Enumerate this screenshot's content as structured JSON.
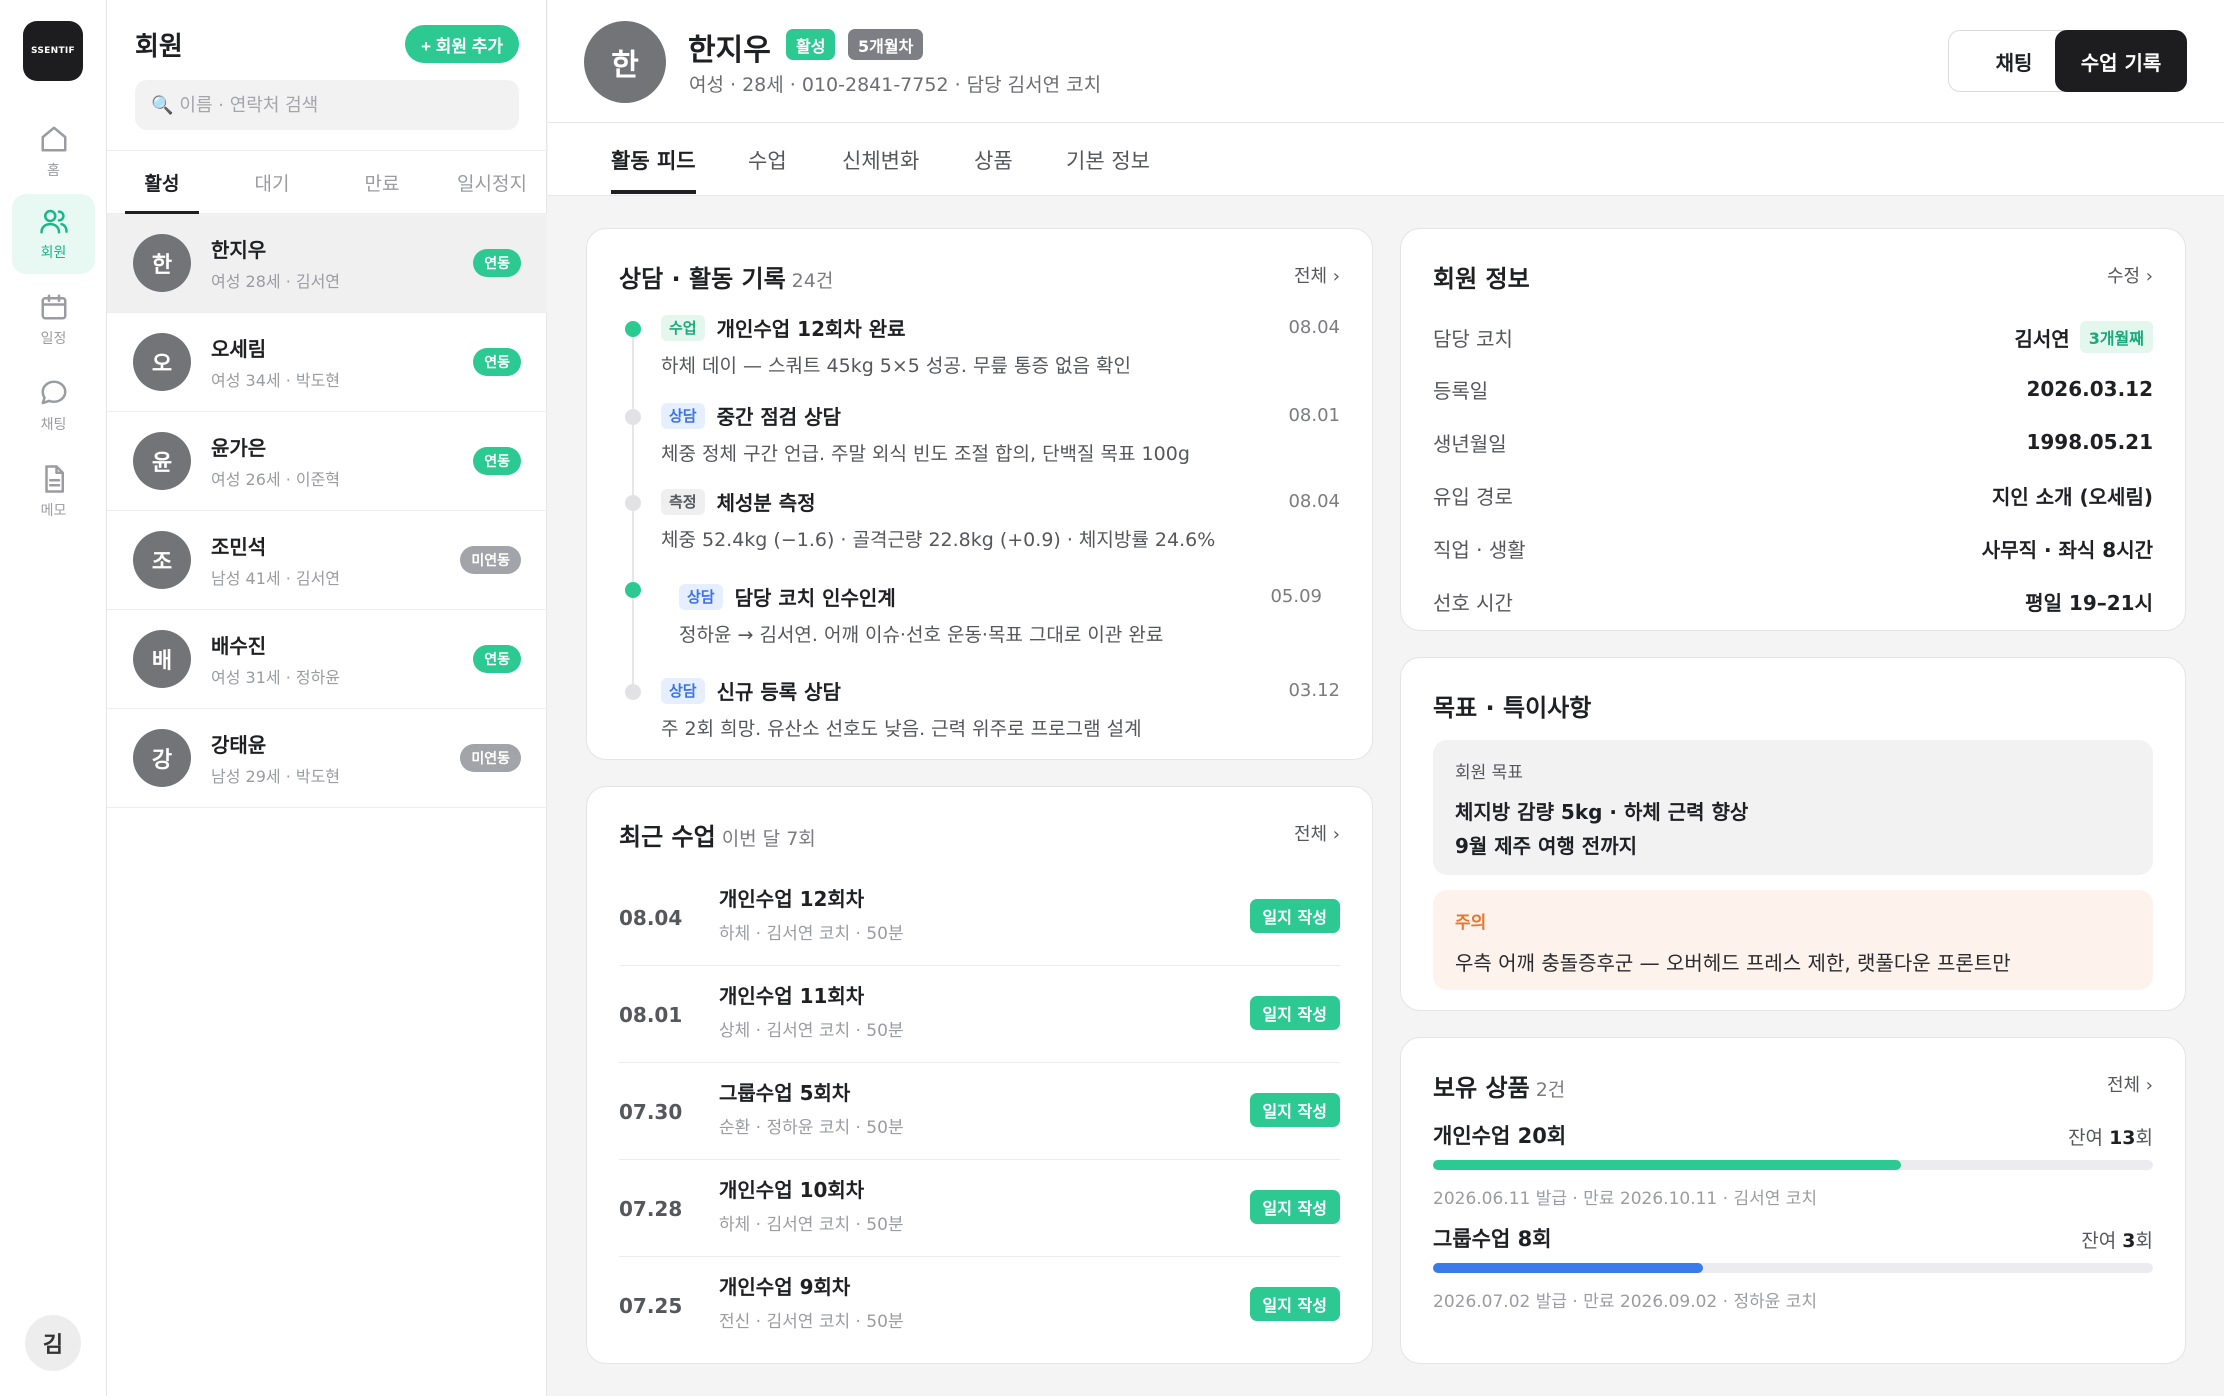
{
  "app": {
    "logo": "SSENTIF"
  },
  "rail": [
    {
      "icon": "home-icon",
      "label": "홈"
    },
    {
      "icon": "members-icon",
      "label": "회원"
    },
    {
      "icon": "calendar-icon",
      "label": "일정"
    },
    {
      "icon": "chat-icon",
      "label": "채팅"
    },
    {
      "icon": "memo-icon",
      "label": "메모"
    }
  ],
  "user_avatar": "김",
  "members_panel": {
    "title": "회원",
    "add_label": "+ 회원 추가",
    "search_placeholder": "이름 · 연락처 검색",
    "tabs": [
      "활성",
      "대기",
      "만료",
      "일시정지"
    ],
    "members": [
      {
        "initial": "한",
        "name": "한지우",
        "sub": "여성 28세 · 김서연",
        "status": "연동"
      },
      {
        "initial": "오",
        "name": "오세림",
        "sub": "여성 34세 · 박도현",
        "status": "연동"
      },
      {
        "initial": "윤",
        "name": "윤가은",
        "sub": "여성 26세 · 이준혁",
        "status": "연동"
      },
      {
        "initial": "조",
        "name": "조민석",
        "sub": "남성 41세 · 김서연",
        "status": "미연동"
      },
      {
        "initial": "배",
        "name": "배수진",
        "sub": "여성 31세 · 정하윤",
        "status": "연동"
      },
      {
        "initial": "강",
        "name": "강태윤",
        "sub": "남성 29세 · 박도현",
        "status": "미연동"
      }
    ]
  },
  "profile": {
    "initial": "한",
    "name": "한지우",
    "status_tag": "활성",
    "month_tag": "5개월차",
    "info": "여성 · 28세 · 010-2841-7752 · 담당 김서연 코치",
    "chat_label": "채팅",
    "record_label": "수업 기록"
  },
  "main_tabs": [
    "활동 피드",
    "수업",
    "신체변화",
    "상품",
    "기본 정보"
  ],
  "activity": {
    "title": "상담 · 활동 기록",
    "count": "24건",
    "link": "전체 ›",
    "events": [
      {
        "chip": "수업",
        "title": "개인수업 12회차 완료",
        "desc": "하체 데이 — 스쿼트 45kg 5×5 성공. 무릎 통증 없음 확인",
        "date": "08.04"
      },
      {
        "chip": "상담",
        "title": "중간 점검 상담",
        "desc": "체중 정체 구간 언급. 주말 외식 빈도 조절 합의, 단백질 목표 100g",
        "date": "08.01"
      },
      {
        "chip": "측정",
        "title": "체성분 측정",
        "desc": "체중 52.4kg (−1.6) · 골격근량 22.8kg (+0.9) · 체지방률 24.6%",
        "date": "08.04"
      },
      {
        "chip": "상담",
        "title": "담당 코치 인수인계",
        "desc": "정하윤 → 김서연. 어깨 이슈·선호 운동·목표 그대로 이관 완료",
        "date": "05.09"
      },
      {
        "chip": "상담",
        "title": "신규 등록 상담",
        "desc": "주 2회 희망. 유산소 선호도 낮음. 근력 위주로 프로그램 설계",
        "date": "03.12"
      }
    ]
  },
  "classes": {
    "title": "최근 수업",
    "count": "이번 달 7회",
    "link": "전체 ›",
    "rows": [
      {
        "date": "08.04",
        "name": "개인수업 12회차",
        "sub": "하체 · 김서연 코치 · 50분",
        "action": "일지 작성"
      },
      {
        "date": "08.01",
        "name": "개인수업 11회차",
        "sub": "상체 · 김서연 코치 · 50분",
        "action": "일지 작성"
      },
      {
        "date": "07.30",
        "name": "그룹수업 5회차",
        "sub": "순환 · 정하윤 코치 · 50분",
        "action": "일지 작성"
      },
      {
        "date": "07.28",
        "name": "개인수업 10회차",
        "sub": "하체 · 김서연 코치 · 50분",
        "action": "일지 작성"
      },
      {
        "date": "07.25",
        "name": "개인수업 9회차",
        "sub": "전신 · 김서연 코치 · 50분",
        "action": "일지 작성"
      }
    ]
  },
  "info": {
    "title": "회원 정보",
    "link": "수정 ›",
    "coach_badge": "3개월째",
    "rows": [
      {
        "label": "담당 코치",
        "value": "김서연"
      },
      {
        "label": "등록일",
        "value": "2026.03.12"
      },
      {
        "label": "생년월일",
        "value": "1998.05.21"
      },
      {
        "label": "유입 경로",
        "value": "지인 소개 (오세림)"
      },
      {
        "label": "직업 · 생활",
        "value": "사무직 · 좌식 8시간"
      },
      {
        "label": "선호 시간",
        "value": "평일 19–21시"
      }
    ]
  },
  "goals": {
    "title": "목표 · 특이사항",
    "goal_label": "회원 목표",
    "goal_line1": "체지방 감량 5kg · 하체 근력 향상",
    "goal_line2": "9월 제주 여행 전까지",
    "warn_label": "주의",
    "warn_text": "우측 어깨 충돌증후군 — 오버헤드 프레스 제한, 랫풀다운 프론트만"
  },
  "products": {
    "title": "보유 상품",
    "count": "2건",
    "link": "전체 ›",
    "items": [
      {
        "name": "개인수업 20회",
        "remain_prefix": "잔여 ",
        "remain": "13",
        "remain_suffix": "회",
        "progress": 0.65,
        "color": "#2cc993",
        "meta": "2026.06.11 발급 · 만료 2026.10.11 · 김서연 코치"
      },
      {
        "name": "그룹수업 8회",
        "remain_prefix": "잔여 ",
        "remain": "3",
        "remain_suffix": "회",
        "progress": 0.375,
        "color": "#3b7be8",
        "meta": "2026.07.02 발급 · 만료 2026.09.02 · 정하윤 코치"
      }
    ]
  },
  "colors": {
    "accent": "#2cc993",
    "dark": "#1d1d1f",
    "warn": "#e8762a",
    "blue": "#3b7be8"
  }
}
